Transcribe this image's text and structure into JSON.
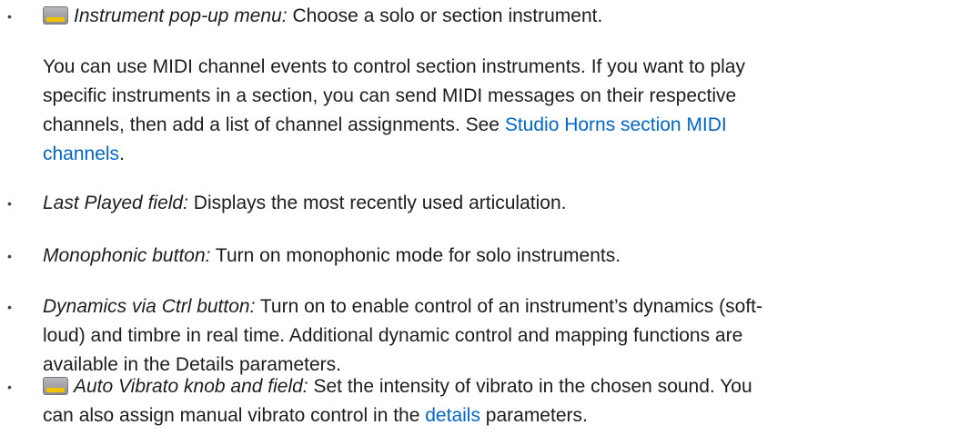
{
  "items": [
    {
      "term": "Instrument pop-up menu:",
      "desc": " Choose a solo or section instrument.",
      "icon": "instrument-thumbnail-icon"
    },
    {
      "para_lines": [
        "You can use MIDI channel events to control section instruments. If you want to play",
        "specific instruments in a section, you can send MIDI messages on their respective",
        "channels, then add a list of channel assignments. See "
      ],
      "link_part1": "Studio Horns section MIDI",
      "link_part2": "channels",
      "after_link": "."
    },
    {
      "term": "Last Played field:",
      "desc": " Displays the most recently used articulation."
    },
    {
      "term": "Monophonic button:",
      "desc": " Turn on monophonic mode for solo instruments."
    },
    {
      "term": "Dynamics via Ctrl button:",
      "desc_line1": " Turn on to enable control of an instrument’s dynamics (soft-",
      "desc_line2": "loud) and timbre in real time. Additional dynamic control and mapping functions are",
      "desc_line3": "available in the Details parameters."
    },
    {
      "term": "Auto Vibrato knob and field:",
      "desc_line1": " Set the intensity of vibrato in the chosen sound. You",
      "desc_line2_a": "can also assign manual vibrato control in the ",
      "link": "details",
      "desc_line2_b": " parameters.",
      "icon": "vibrato-thumbnail-icon"
    }
  ],
  "bullet_char": "•"
}
